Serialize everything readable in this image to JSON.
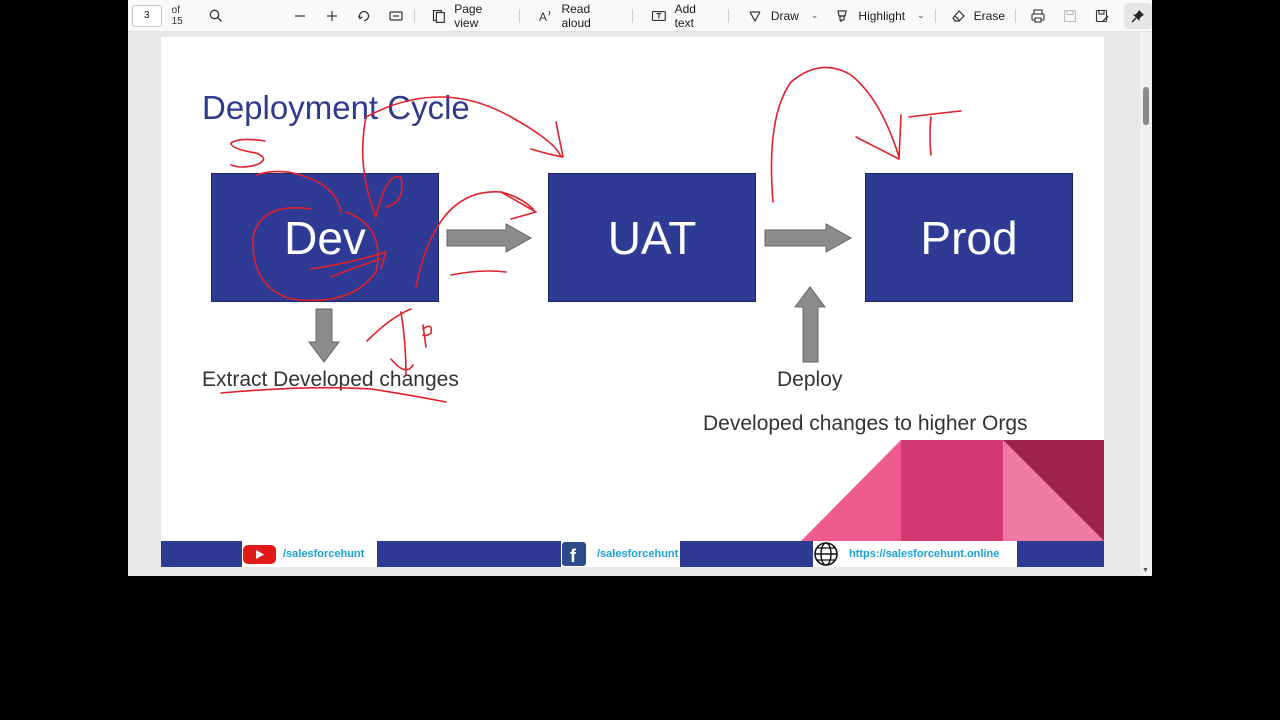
{
  "toolbar": {
    "page_number": "3",
    "page_total": "of 15",
    "page_view_label": "Page view",
    "read_aloud_label": "Read aloud",
    "add_text_label": "Add text",
    "draw_label": "Draw",
    "highlight_label": "Highlight",
    "erase_label": "Erase"
  },
  "slide": {
    "title": "Deployment Cycle",
    "boxes": {
      "dev": "Dev",
      "uat": "UAT",
      "prod": "Prod"
    },
    "captions": {
      "extract": "Extract Developed changes",
      "deploy": "Deploy",
      "higher": "Developed changes to higher Orgs"
    },
    "footer": {
      "youtube": "/salesforcehunt",
      "facebook": "/salesforcehunt",
      "website": "https://salesforcehunt.online"
    }
  },
  "colors": {
    "accent_blue": "#2e3a94",
    "ink_red": "#e0202a",
    "pink": "#ef5a8f"
  }
}
